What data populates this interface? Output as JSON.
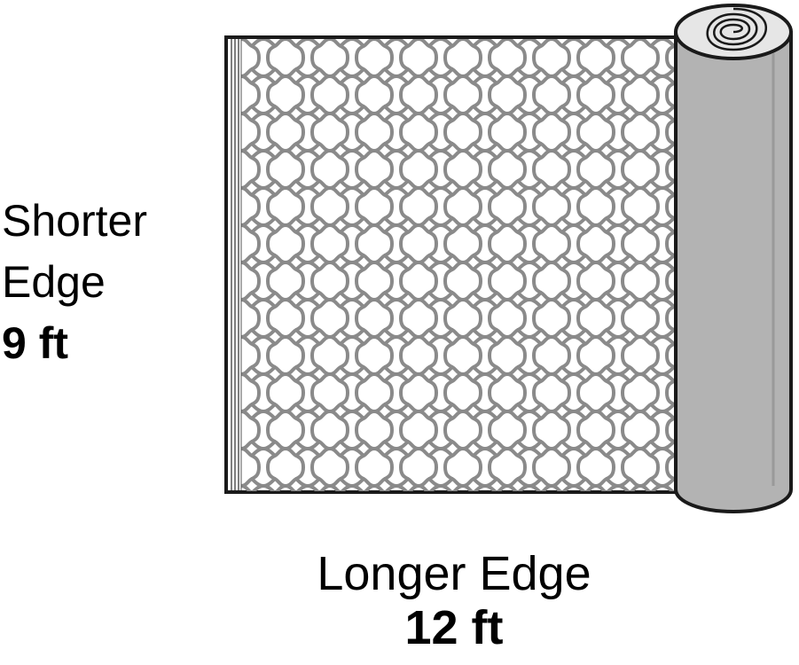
{
  "shorter_edge": {
    "name": "Shorter",
    "word": "Edge",
    "measure": "9 ft"
  },
  "longer_edge": {
    "name": "Longer Edge",
    "measure": "12 ft"
  },
  "colors": {
    "outline": "#1a1a1a",
    "pattern": "#8a8a8a",
    "roll_fill": "#b3b3b3",
    "sheet_fill": "#ffffff"
  },
  "illustration": {
    "subject": "rolled-out-rug-roll",
    "pattern": "moroccan-trellis"
  }
}
